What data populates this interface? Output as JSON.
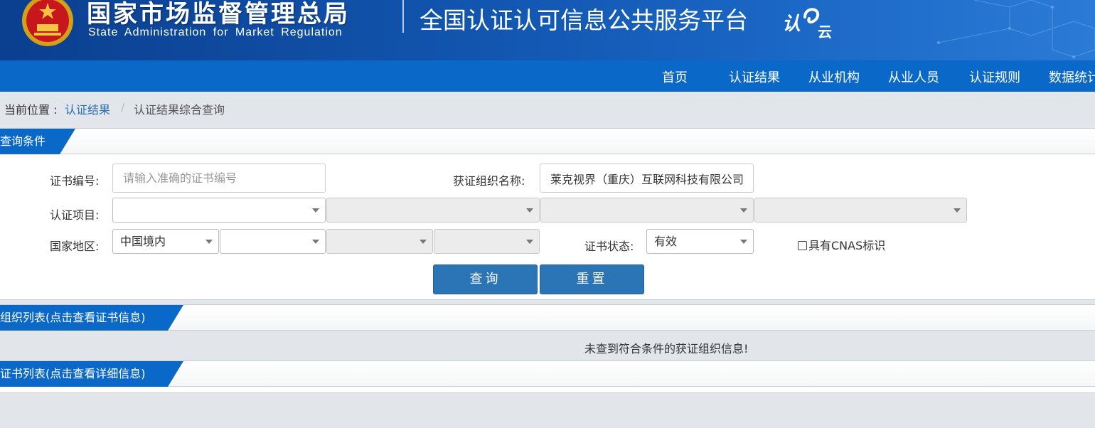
{
  "header": {
    "title_cn": "国家市场监督管理总局",
    "title_en": "State Administration  for  Market Regulation",
    "platform": "全国认证认可信息公共服务平台",
    "logo_text": "认e云"
  },
  "nav": {
    "items": [
      "首页",
      "认证结果",
      "从业机构",
      "从业人员",
      "认证规则",
      "数据统计"
    ]
  },
  "breadcrumb": {
    "label": "当前位置 :",
    "link": "认证结果",
    "separator": "/",
    "current": "认证结果综合查询"
  },
  "query_section": {
    "title": "查询条件"
  },
  "form": {
    "cert_no_label": "证书编号:",
    "cert_no_placeholder": "请输入准确的证书编号",
    "org_name_label": "获证组织名称:",
    "org_name_value": "莱克视界（重庆）互联网科技有限公司",
    "project_label": "认证项目:",
    "region_label": "国家地区:",
    "region_value": "中国境内",
    "status_label": "证书状态:",
    "status_value": "有效",
    "cnas_label": "具有CNAS标识",
    "query_button": "查询",
    "reset_button": "重置"
  },
  "org_list": {
    "title": "组织列表(点击查看证书信息)",
    "empty_message": "未查到符合条件的获证组织信息!"
  },
  "cert_list": {
    "title": "证书列表(点击查看详细信息)"
  },
  "colors": {
    "primary_blue": "#0a69c8",
    "header_dark": "#0b3f8f",
    "button_blue": "#2b74b6",
    "link_blue": "#2a6fb6",
    "page_bg": "#e2e6ea"
  }
}
